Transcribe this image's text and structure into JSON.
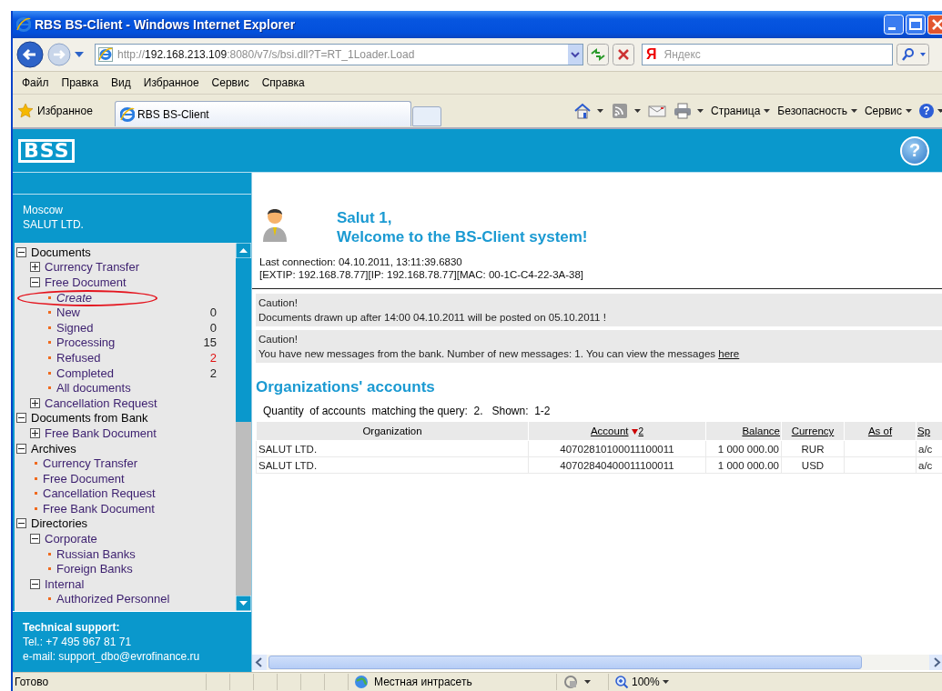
{
  "window": {
    "title": "RBS BS-Client - Windows Internet Explorer"
  },
  "address_bar": {
    "scheme": "http://",
    "host": "192.168.213.109",
    "path": ":8080/v7/s/bsi.dll?T=RT_1Loader.Load"
  },
  "search": {
    "logo": "Я",
    "placeholder": "Яндекс"
  },
  "menu": [
    "Файл",
    "Правка",
    "Вид",
    "Избранное",
    "Сервис",
    "Справка"
  ],
  "favorites": {
    "label": "Избранное"
  },
  "tabs": [
    {
      "label": "RBS BS-Client",
      "selected": true
    }
  ],
  "command_bar": {
    "menus": [
      "Страница",
      "Безопасность",
      "Сервис"
    ],
    "help_label": "?"
  },
  "header": {
    "logo": "BSS",
    "help_label": "?"
  },
  "sidebar": {
    "city": "Moscow",
    "company": "SALUT LTD.",
    "tree": [
      {
        "kind": "folder",
        "label": "Documents",
        "expanded": true,
        "selected": false,
        "children": [
          {
            "kind": "folder",
            "label": "Currency Transfer",
            "expanded": false,
            "selected": false
          },
          {
            "kind": "folder",
            "label": "Free Document",
            "expanded": true,
            "selected": false,
            "children": [
              {
                "kind": "leaf",
                "label": "Create",
                "selected": true
              },
              {
                "kind": "leaf",
                "label": "New",
                "count": "0",
                "alert": false,
                "selected": false
              },
              {
                "kind": "leaf",
                "label": "Signed",
                "count": "0",
                "alert": false,
                "selected": false
              },
              {
                "kind": "leaf",
                "label": "Processing",
                "count": "15",
                "alert": false,
                "selected": false
              },
              {
                "kind": "leaf",
                "label": "Refused",
                "count": "2",
                "alert": true,
                "selected": false
              },
              {
                "kind": "leaf",
                "label": "Completed",
                "count": "2",
                "alert": false,
                "selected": false
              },
              {
                "kind": "leaf",
                "label": "All documents",
                "selected": false
              }
            ]
          },
          {
            "kind": "folder",
            "label": "Cancellation Request",
            "expanded": false,
            "selected": false
          }
        ]
      },
      {
        "kind": "folder",
        "label": "Documents from Bank",
        "expanded": true,
        "selected": false,
        "children": [
          {
            "kind": "folder",
            "label": "Free Bank Document",
            "expanded": false,
            "selected": false
          }
        ]
      },
      {
        "kind": "folder",
        "label": "Archives",
        "expanded": true,
        "selected": false,
        "children": [
          {
            "kind": "leaf",
            "label": "Currency Transfer",
            "selected": false
          },
          {
            "kind": "leaf",
            "label": "Free Document",
            "selected": false
          },
          {
            "kind": "leaf",
            "label": "Cancellation Request",
            "selected": false
          },
          {
            "kind": "leaf",
            "label": "Free Bank Document",
            "selected": false
          }
        ]
      },
      {
        "kind": "folder",
        "label": "Directories",
        "expanded": true,
        "selected": false,
        "children": [
          {
            "kind": "folder",
            "label": "Corporate",
            "expanded": true,
            "selected": false,
            "children": [
              {
                "kind": "leaf",
                "label": "Russian Banks",
                "selected": false
              },
              {
                "kind": "leaf",
                "label": "Foreign Banks",
                "selected": false
              }
            ]
          },
          {
            "kind": "folder",
            "label": "Internal",
            "expanded": true,
            "selected": false,
            "children": [
              {
                "kind": "leaf",
                "label": "Authorized Personnel",
                "selected": false
              }
            ]
          }
        ]
      }
    ],
    "support": {
      "title": "Technical support:",
      "phone": "Tel.: +7 495 967 81 71",
      "email": "e-mail: support_dbo@evrofinance.ru"
    }
  },
  "welcome": {
    "name": "Salut 1,",
    "greeting": "Welcome to the BS-Client system!",
    "last_connection": "Last connection: 04.10.2011, 13:11:39.6830",
    "network": "[EXTIP: 192.168.78.77][IP: 192.168.78.77][MAC: 00-1C-C4-22-3A-38]"
  },
  "notices": [
    {
      "title": "Caution!",
      "text": "Documents drawn up after 14:00 04.10.2011 will be posted on 05.10.2011 !"
    },
    {
      "title": "Caution!",
      "text": "You have new messages from the bank. Number of new messages: 1. You can view the messages",
      "link": "here"
    }
  ],
  "accounts": {
    "title": "Organizations' accounts",
    "summary": "Quantity  of accounts  matching the query:  2.   Shown:  1-2",
    "columns": [
      {
        "label": "Organization",
        "link": false,
        "sorted": false
      },
      {
        "label": "Account",
        "link": true,
        "sorted": true,
        "sort_rank": "2"
      },
      {
        "label": "Balance",
        "link": true,
        "sorted": false
      },
      {
        "label": "Currency",
        "link": true,
        "sorted": false
      },
      {
        "label": "As of",
        "link": true,
        "sorted": false
      },
      {
        "label": "Sp",
        "link": true,
        "sorted": false
      }
    ],
    "rows": [
      {
        "organization": "SALUT LTD.",
        "account": "40702810100011100011",
        "balance": "1 000 000.00",
        "currency": "RUR",
        "column_6": "a/c"
      },
      {
        "organization": "SALUT LTD.",
        "account": "40702840400011100011",
        "balance": "1 000 000.00",
        "currency": "USD",
        "column_6": "a/c"
      }
    ]
  },
  "status_bar": {
    "text": "Готово",
    "zone": "Местная интрасеть",
    "zoom": "100%"
  }
}
